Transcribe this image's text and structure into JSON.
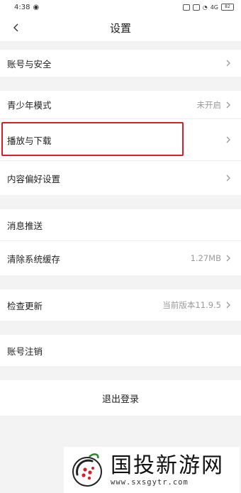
{
  "status_bar": {
    "time": "4:38",
    "signal": "4G",
    "battery": "82"
  },
  "header": {
    "title": "设置",
    "back_icon": "chevron-left-icon"
  },
  "groups": [
    {
      "items": [
        {
          "label": "账号与安全",
          "value": ""
        }
      ]
    },
    {
      "items": [
        {
          "label": "青少年模式",
          "value": "未开启"
        },
        {
          "label": "播放与下载",
          "value": ""
        },
        {
          "label": "内容偏好设置",
          "value": ""
        }
      ]
    },
    {
      "items": [
        {
          "label": "消息推送",
          "value": ""
        },
        {
          "label": "清除系统缓存",
          "value": "1.27MB"
        }
      ]
    },
    {
      "items": [
        {
          "label": "检查更新",
          "value": "当前版本11.9.5"
        }
      ]
    },
    {
      "items": [
        {
          "label": "账号注销",
          "value": ""
        }
      ]
    }
  ],
  "logout_label": "退出登录",
  "highlight_color": "#d3202a",
  "watermark": {
    "name": "国投新游网",
    "url": "www.sxsgytr.com"
  }
}
